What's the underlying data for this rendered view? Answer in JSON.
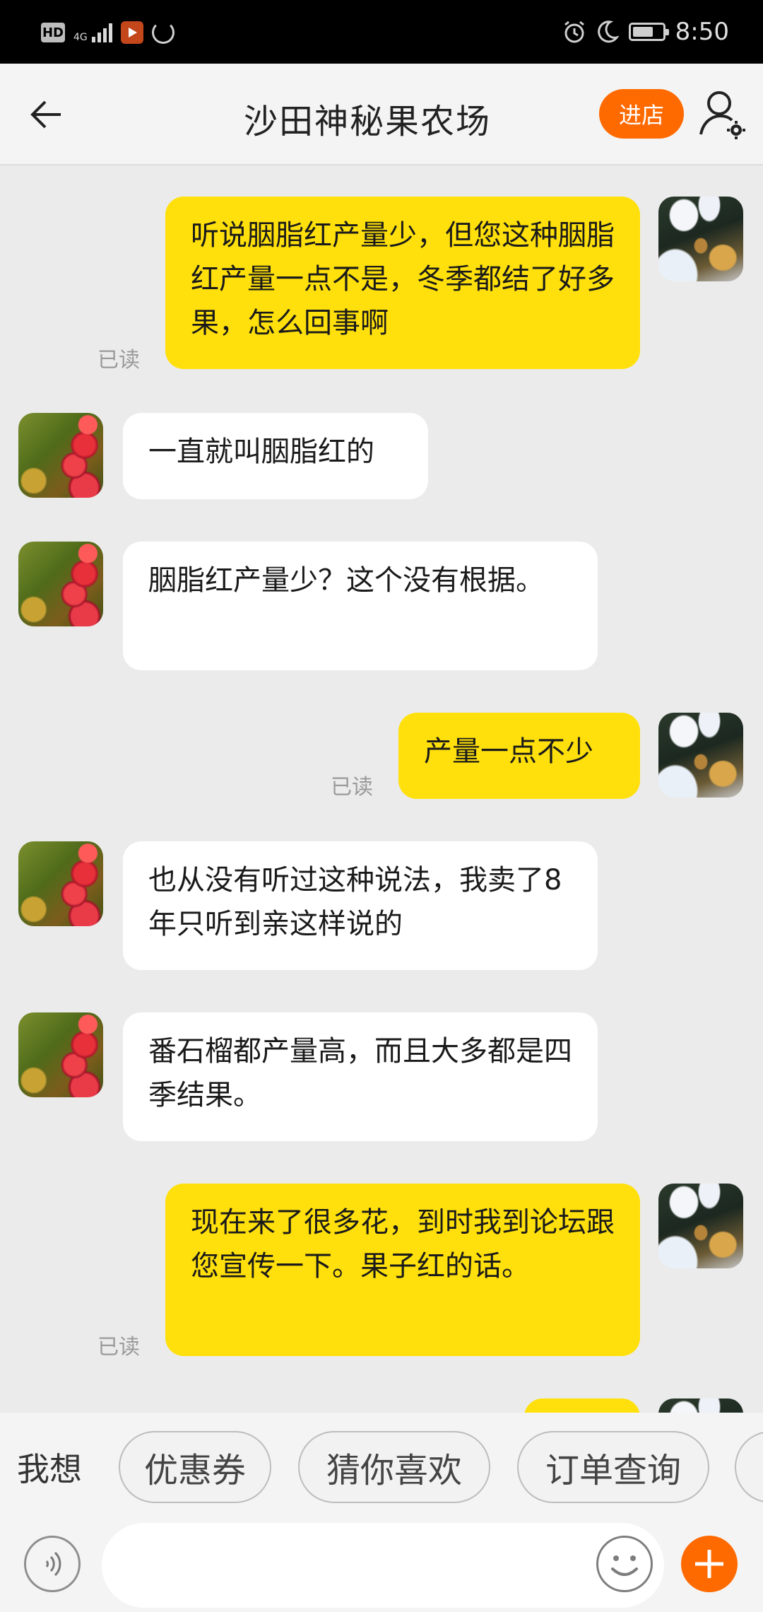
{
  "status_bar": {
    "hd": "HD",
    "network": "4G",
    "time": "8:50",
    "icons": [
      "hd-icon",
      "signal-icon",
      "app-icon",
      "sync-icon",
      "alarm-icon",
      "moon-icon",
      "battery-icon"
    ]
  },
  "header": {
    "title": "沙田神秘果农场",
    "shop_button": "进店",
    "back_icon": "back-arrow-icon",
    "profile_icon": "user-settings-icon"
  },
  "chat": {
    "read_label": "已读",
    "messages": [
      {
        "from": "me",
        "text": "听说胭脂红产量少，但您这种胭脂红产量一点不是，冬季都结了好多果，怎么回事啊",
        "read": true
      },
      {
        "from": "seller",
        "text": "一直就叫胭脂红的"
      },
      {
        "from": "seller",
        "text": "胭脂红产量少？这个没有根据。"
      },
      {
        "from": "me",
        "text": "产量一点不少",
        "read": true
      },
      {
        "from": "seller",
        "text": "也从没有听过这种说法，我卖了8年只听到亲这样说的"
      },
      {
        "from": "seller",
        "text": "番石榴都产量高，而且大多都是四季结果。"
      },
      {
        "from": "me",
        "text": "现在来了很多花，到时我到论坛跟您宣传一下。果子红的话。",
        "read": true
      }
    ]
  },
  "quick_bar": {
    "label": "我想",
    "chips": [
      "优惠券",
      "猜你喜欢",
      "订单查询"
    ]
  },
  "input_bar": {
    "placeholder": "",
    "voice_icon": "voice-icon",
    "emoji_icon": "emoji-icon",
    "plus_icon": "plus-icon"
  },
  "colors": {
    "accent": "#ff6a00",
    "my_bubble": "#ffe00c",
    "their_bubble": "#ffffff",
    "chat_bg": "#ebebeb"
  }
}
